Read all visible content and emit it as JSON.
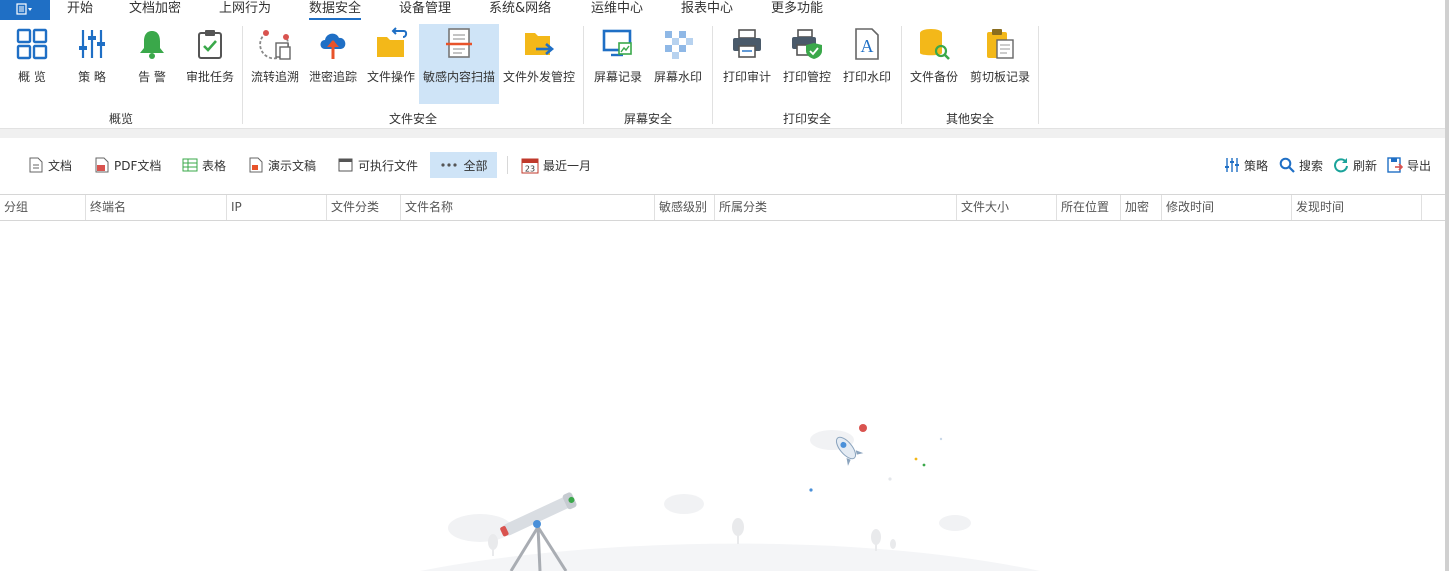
{
  "menubar": {
    "app_icon": "app-menu-icon",
    "tabs": [
      {
        "label": "开始"
      },
      {
        "label": "文档加密"
      },
      {
        "label": "上网行为"
      },
      {
        "label": "数据安全",
        "active": true
      },
      {
        "label": "设备管理"
      },
      {
        "label": "系统&网络"
      },
      {
        "label": "运维中心"
      },
      {
        "label": "报表中心"
      },
      {
        "label": "更多功能"
      }
    ]
  },
  "ribbon": {
    "groups": [
      {
        "label": "概览",
        "buttons": [
          {
            "label": "概 览",
            "icon": "overview-grid-icon"
          },
          {
            "label": "策 略",
            "icon": "policy-sliders-icon"
          },
          {
            "label": "告 警",
            "icon": "alarm-bell-icon"
          },
          {
            "label": "审批任务",
            "icon": "approval-clipboard-icon"
          }
        ]
      },
      {
        "label": "文件安全",
        "buttons": [
          {
            "label": "流转追溯",
            "icon": "trace-flow-icon"
          },
          {
            "label": "泄密追踪",
            "icon": "leak-upload-icon"
          },
          {
            "label": "文件操作",
            "icon": "file-operation-folder-icon"
          },
          {
            "label": "敏感内容扫描",
            "icon": "sensitive-scan-icon",
            "active": true
          },
          {
            "label": "文件外发管控",
            "icon": "file-outgoing-folder-icon"
          }
        ]
      },
      {
        "label": "屏幕安全",
        "buttons": [
          {
            "label": "屏幕记录",
            "icon": "screen-record-icon"
          },
          {
            "label": "屏幕水印",
            "icon": "screen-watermark-icon"
          }
        ]
      },
      {
        "label": "打印安全",
        "buttons": [
          {
            "label": "打印审计",
            "icon": "printer-icon"
          },
          {
            "label": "打印管控",
            "icon": "printer-shield-icon"
          },
          {
            "label": "打印水印",
            "icon": "print-watermark-icon"
          }
        ]
      },
      {
        "label": "其他安全",
        "buttons": [
          {
            "label": "文件备份",
            "icon": "file-backup-icon"
          },
          {
            "label": "剪切板记录",
            "icon": "clipboard-record-icon"
          }
        ]
      }
    ]
  },
  "filters": {
    "items": [
      {
        "label": "文档",
        "icon": "document-icon"
      },
      {
        "label": "PDF文档",
        "icon": "pdf-icon"
      },
      {
        "label": "表格",
        "icon": "spreadsheet-icon"
      },
      {
        "label": "演示文稿",
        "icon": "presentation-icon"
      },
      {
        "label": "可执行文件",
        "icon": "executable-icon"
      },
      {
        "label": "全部",
        "icon": "more-dots-icon",
        "active": true
      }
    ],
    "date_range": {
      "label": "最近一月",
      "icon": "calendar-icon",
      "day": "23"
    },
    "actions": [
      {
        "label": "策略",
        "icon": "policy-icon"
      },
      {
        "label": "搜索",
        "icon": "search-icon"
      },
      {
        "label": "刷新",
        "icon": "refresh-icon"
      },
      {
        "label": "导出",
        "icon": "export-icon"
      }
    ]
  },
  "table": {
    "columns": [
      "分组",
      "终端名",
      "IP",
      "文件分类",
      "文件名称",
      "敏感级别",
      "所属分类",
      "文件大小",
      "所在位置",
      "加密",
      "修改时间",
      "发现时间"
    ],
    "rows": []
  },
  "colors": {
    "accent": "#1f6fc5",
    "active_bg": "#cfe4f7"
  }
}
